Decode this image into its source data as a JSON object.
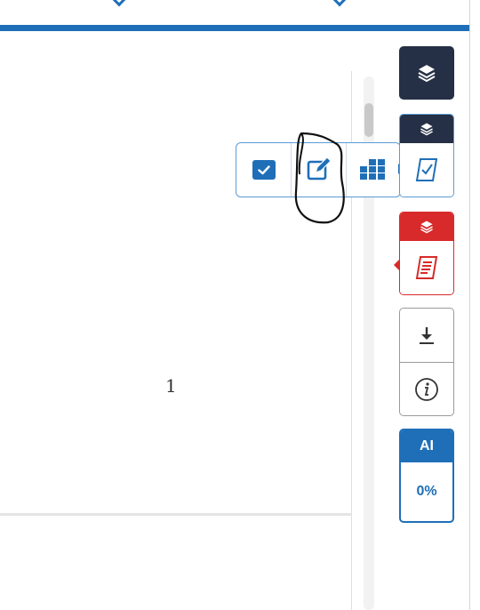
{
  "document": {
    "page_number": "1"
  },
  "toolbar": {
    "buttons": [
      {
        "icon": "check-square-icon"
      },
      {
        "icon": "edit-icon"
      },
      {
        "icon": "grid-icon"
      }
    ]
  },
  "sidebar": {
    "layers_icon": "layers-icon",
    "card_blue_icon": "draft-check-icon",
    "card_red_icon": "document-lines-icon",
    "download_icon": "download-icon",
    "info_icon": "info-icon",
    "ai": {
      "label": "AI",
      "value": "0%"
    }
  },
  "colors": {
    "accent": "#1f6fb8",
    "dark": "#252f45",
    "red": "#d82a2a"
  }
}
